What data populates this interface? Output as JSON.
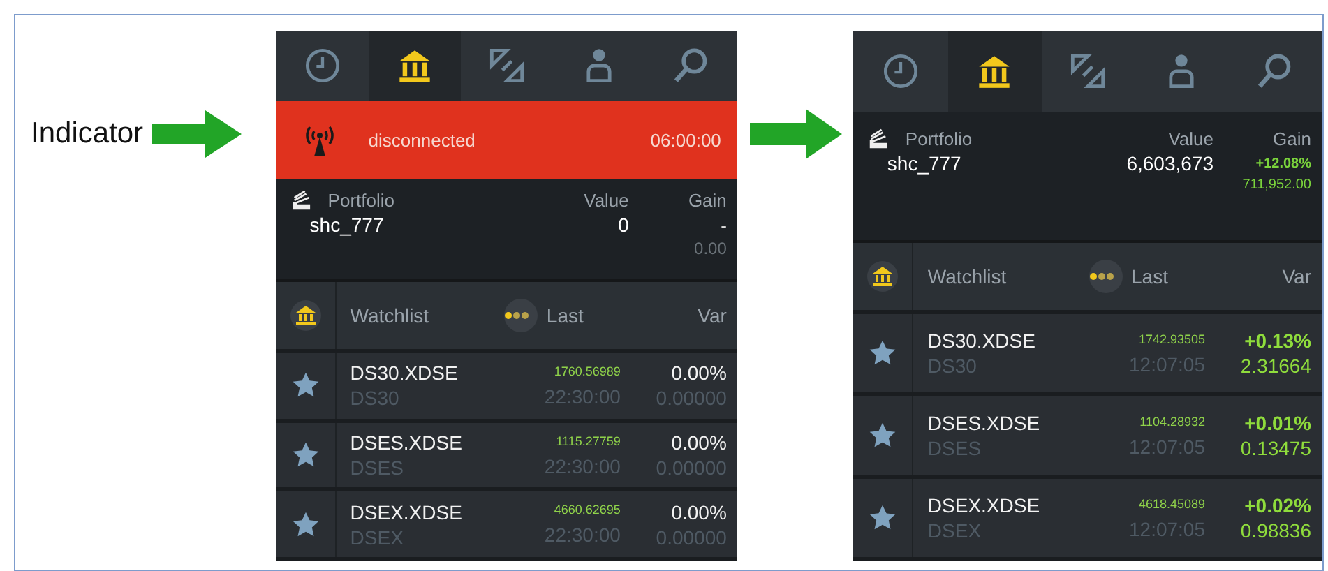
{
  "callout": {
    "label": "Indicator"
  },
  "screens": [
    {
      "tabs": [
        {
          "kind": "clock",
          "selected": false
        },
        {
          "kind": "bank",
          "selected": true
        },
        {
          "kind": "swap",
          "selected": false
        },
        {
          "kind": "person",
          "selected": false
        },
        {
          "kind": "search",
          "selected": false
        }
      ],
      "banner": {
        "text": "disconnected",
        "time": "06:00:00"
      },
      "portfolio": {
        "title": "Portfolio",
        "value_label": "Value",
        "gain_label": "Gain",
        "name": "shc_777",
        "value": "0",
        "gain": "-",
        "gain_amount": "0.00",
        "positive": false
      },
      "watchlist": {
        "title": "Watchlist",
        "last_label": "Last",
        "var_label": "Var",
        "rows": [
          {
            "symbol": "DS30.XDSE",
            "name": "DS30",
            "last": "1760.56989",
            "time": "22:30:00",
            "var_pct": "0.00%",
            "var_abs": "0.00000",
            "positive": false
          },
          {
            "symbol": "DSES.XDSE",
            "name": "DSES",
            "last": "1115.27759",
            "time": "22:30:00",
            "var_pct": "0.00%",
            "var_abs": "0.00000",
            "positive": false
          },
          {
            "symbol": "DSEX.XDSE",
            "name": "DSEX",
            "last": "4660.62695",
            "time": "22:30:00",
            "var_pct": "0.00%",
            "var_abs": "0.00000",
            "positive": false
          }
        ]
      }
    },
    {
      "tabs": [
        {
          "kind": "clock",
          "selected": false
        },
        {
          "kind": "bank",
          "selected": true
        },
        {
          "kind": "swap",
          "selected": false
        },
        {
          "kind": "person",
          "selected": false
        },
        {
          "kind": "search",
          "selected": false
        }
      ],
      "portfolio": {
        "title": "Portfolio",
        "value_label": "Value",
        "gain_label": "Gain",
        "name": "shc_777",
        "value": "6,603,673",
        "gain": "+12.08%",
        "gain_amount": "711,952.00",
        "positive": true
      },
      "watchlist": {
        "title": "Watchlist",
        "last_label": "Last",
        "var_label": "Var",
        "rows": [
          {
            "symbol": "DS30.XDSE",
            "name": "DS30",
            "last": "1742.93505",
            "time": "12:07:05",
            "var_pct": "+0.13%",
            "var_abs": "2.31664",
            "positive": true
          },
          {
            "symbol": "DSES.XDSE",
            "name": "DSES",
            "last": "1104.28932",
            "time": "12:07:05",
            "var_pct": "+0.01%",
            "var_abs": "0.13475",
            "positive": true
          },
          {
            "symbol": "DSEX.XDSE",
            "name": "DSEX",
            "last": "4618.45089",
            "time": "12:07:05",
            "var_pct": "+0.02%",
            "var_abs": "0.98836",
            "positive": true
          }
        ]
      }
    }
  ]
}
